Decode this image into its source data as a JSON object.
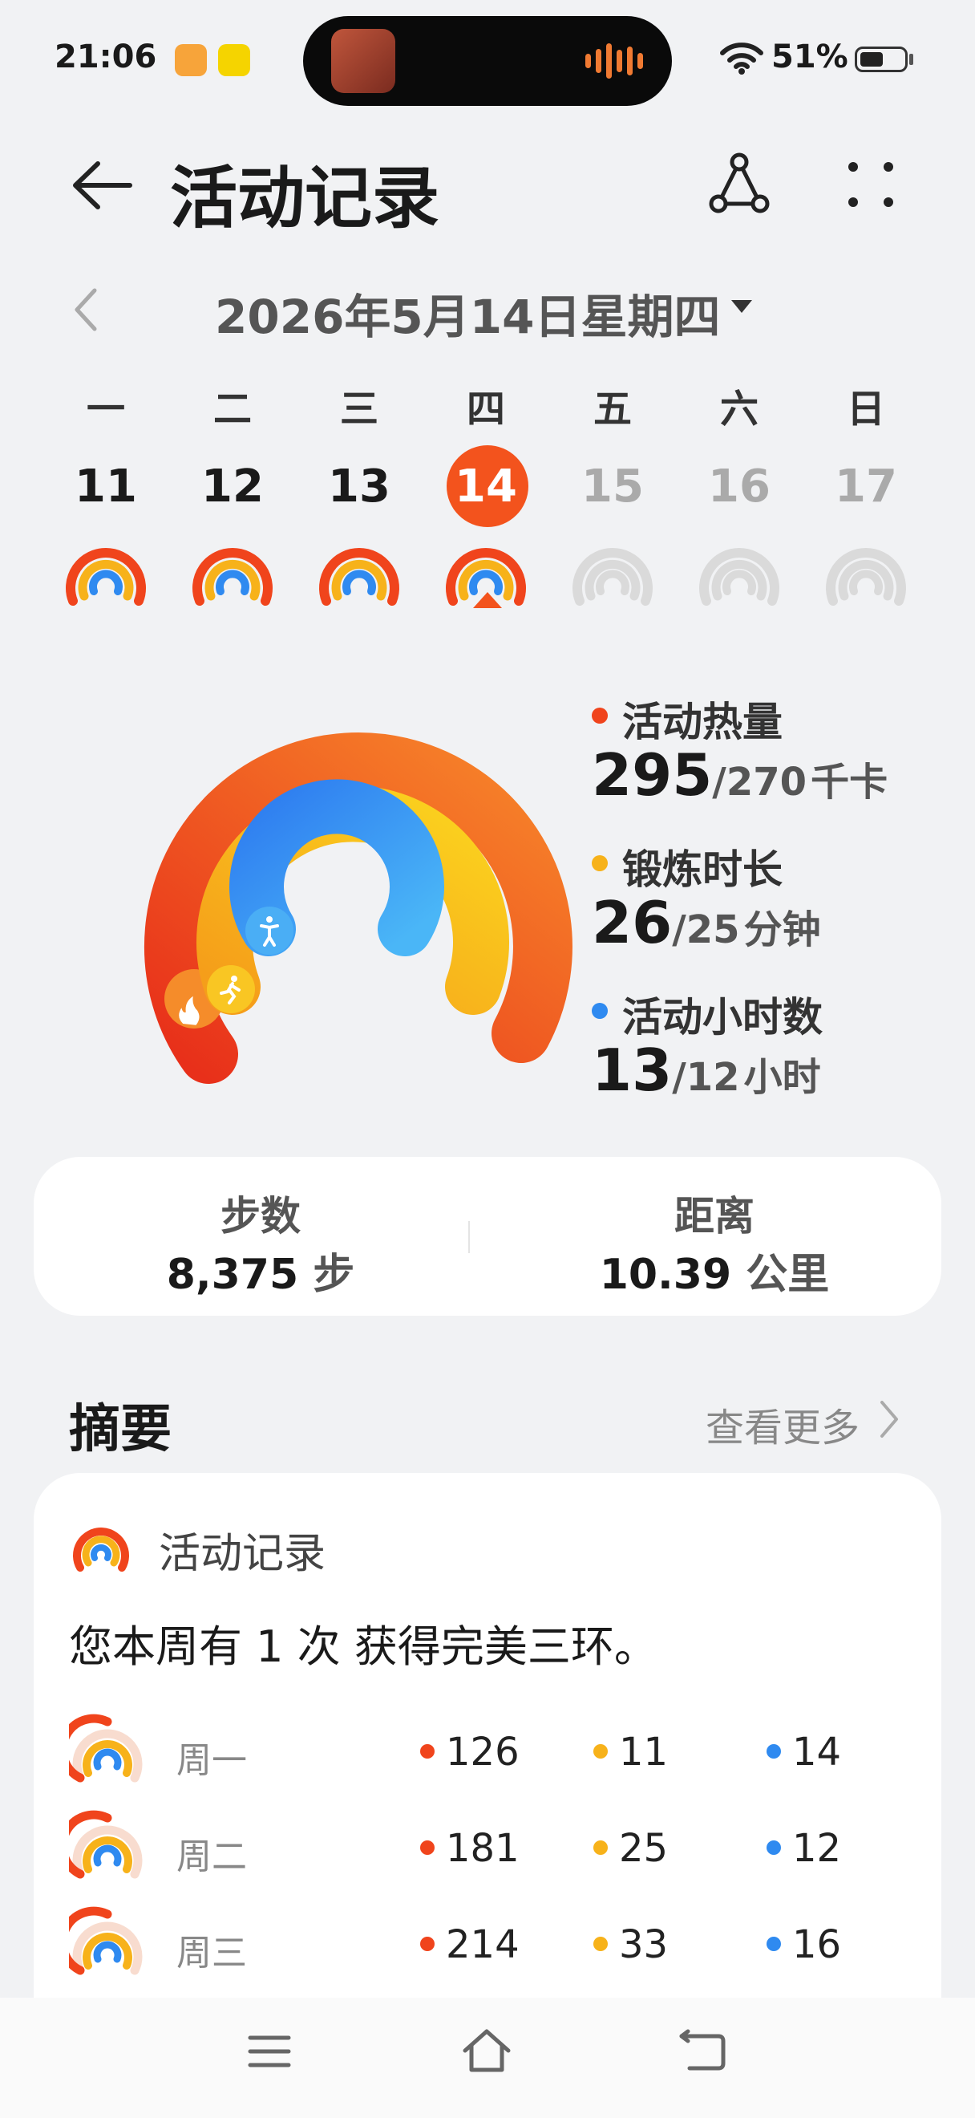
{
  "status": {
    "time": "21:06",
    "battery": "51%"
  },
  "header": {
    "title": "活动记录"
  },
  "date": {
    "selected": "2026年5月14日星期四"
  },
  "week": [
    {
      "day": "一",
      "num": "11"
    },
    {
      "day": "二",
      "num": "12"
    },
    {
      "day": "三",
      "num": "13"
    },
    {
      "day": "四",
      "num": "14"
    },
    {
      "day": "五",
      "num": "15"
    },
    {
      "day": "六",
      "num": "16"
    },
    {
      "day": "日",
      "num": "17"
    }
  ],
  "rings": {
    "calories": {
      "label": "活动热量",
      "value": "295",
      "goal": "/270",
      "unit": "千卡",
      "progress": 1.09
    },
    "exercise": {
      "label": "锻炼时长",
      "value": "26",
      "goal": "/25",
      "unit": "分钟",
      "progress": 1.04
    },
    "stand": {
      "label": "活动小时数",
      "value": "13",
      "goal": "/12",
      "unit": "小时",
      "progress": 1.08
    }
  },
  "stats": {
    "steps_label": "步数",
    "steps_value": "8,375",
    "steps_unit": "步",
    "distance_label": "距离",
    "distance_value": "10.39",
    "distance_unit": "公里"
  },
  "summary": {
    "section_title": "摘要",
    "more": "查看更多",
    "card_title": "活动记录",
    "text": "您本周有 1 次 获得完美三环。",
    "rows": [
      {
        "day": "周一",
        "cal": "126",
        "ex": "11",
        "st": "14"
      },
      {
        "day": "周二",
        "cal": "181",
        "ex": "25",
        "st": "12"
      },
      {
        "day": "周三",
        "cal": "214",
        "ex": "33",
        "st": "16"
      }
    ]
  },
  "colors": {
    "red": "#f0441c",
    "yellow": "#f7b21a",
    "blue": "#2f8af0",
    "today": "#f3531d"
  }
}
